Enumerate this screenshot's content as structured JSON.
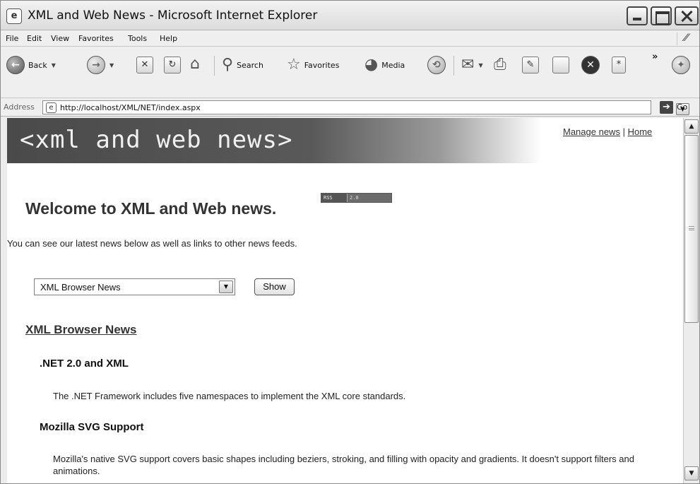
{
  "window": {
    "title": "XML and Web News - Microsoft Internet Explorer"
  },
  "menu": [
    "File",
    "Edit",
    "View",
    "Favorites",
    "Tools",
    "Help"
  ],
  "toolbar": {
    "back_label": "Back",
    "search_label": "Search",
    "favorites_label": "Favorites",
    "media_label": "Media"
  },
  "address": {
    "label": "Address",
    "url": "http://localhost/XML/NET/index.aspx",
    "go_label": "Go"
  },
  "banner": {
    "logo_text": "<xml and web news>",
    "manage_link": "Manage news",
    "separator": "|",
    "home_link": "Home"
  },
  "page": {
    "welcome": "Welcome to XML and Web news.",
    "rss_badge_left": "RSS",
    "rss_badge_right": "2.0",
    "intro": "You can see our latest news below as well as links to other news feeds.",
    "feed_select_value": "XML Browser News",
    "show_button": "Show",
    "feed_title": "XML Browser News",
    "items": [
      {
        "title": ".NET 2.0 and XML",
        "description": "The .NET Framework includes five namespaces to implement the XML core standards."
      },
      {
        "title": "Mozilla SVG Support",
        "description": "Mozilla's native SVG support covers basic shapes including beziers, stroking, and filling with opacity and gradients. It doesn't support filters and animations."
      }
    ]
  }
}
